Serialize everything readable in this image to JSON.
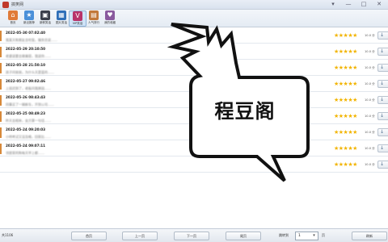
{
  "window": {
    "title": "搞笑网",
    "controls": [
      "▾",
      "—",
      "□",
      "✕"
    ]
  },
  "toolbar": {
    "items": [
      {
        "label": "首页",
        "icon": "house-icon",
        "color": "#e07b39",
        "glyph": "⌂",
        "active": false
      },
      {
        "label": "新近推荐",
        "icon": "star-icon",
        "color": "#4a90d9",
        "glyph": "★",
        "active": false
      },
      {
        "label": "新鲜笑话",
        "icon": "monitor-icon",
        "color": "#3b3f4a",
        "glyph": "▣",
        "active": false
      },
      {
        "label": "图片笑话",
        "icon": "photo-icon",
        "color": "#2f6fb8",
        "glyph": "▦",
        "active": false
      },
      {
        "label": "VIP笑话",
        "icon": "vip-icon",
        "color": "#b8336a",
        "glyph": "V",
        "active": true
      },
      {
        "label": "人气排行",
        "icon": "chart-icon",
        "color": "#c2793a",
        "glyph": "▤",
        "active": false
      },
      {
        "label": "我的收藏",
        "icon": "favorites-icon",
        "color": "#8a5a9e",
        "glyph": "♥",
        "active": false
      }
    ]
  },
  "list": {
    "rows": [
      {
        "timestamp": "2022-05-30 07:02:40",
        "snippet": "我某天和朋友去吃饭，服务员说……",
        "rating": "10.0 分"
      },
      {
        "timestamp": "2022-05-29 20:10:50",
        "snippet": "老婆说要去做美容，我说你……",
        "rating": "10.0 分"
      },
      {
        "timestamp": "2022-05-28 21:50:10",
        "snippet": "孩子问爸爸，为什么天是蓝的……",
        "rating": "10.0 分"
      },
      {
        "timestamp": "2022-05-27 09:02:46",
        "snippet": "上班迟到了，老板问我原因……",
        "rating": "10.0 分"
      },
      {
        "timestamp": "2022-05-26 08:43:43",
        "snippet": "同事买了一辆新车，开到公司……",
        "rating": "10.0 分"
      },
      {
        "timestamp": "2022-05-25 08:49:23",
        "snippet": "昨天去相亲，女方第一句话……",
        "rating": "10.0 分"
      },
      {
        "timestamp": "2022-05-24 09:20:03",
        "snippet": "小明考试又没及格，回家后……",
        "rating": "10.0 分"
      },
      {
        "timestamp": "2022-05-24 09:07:11",
        "snippet": "邻居家的狗每天早上都……",
        "rating": "10.0 分"
      },
      {
        "timestamp": "",
        "snippet": "",
        "rating": "10.0 分"
      }
    ],
    "stars": "★★★★★",
    "star_score": 5,
    "row_button_glyph": "↓"
  },
  "overlay": {
    "text": "程豆阁"
  },
  "pagination": {
    "count_text": "共1106",
    "first": "首页",
    "prev": "上一页",
    "next": "下一页",
    "last": "尾页",
    "jump_label": "跳转到",
    "page_value": "1",
    "page_unit": "页",
    "refresh": "刷新"
  }
}
